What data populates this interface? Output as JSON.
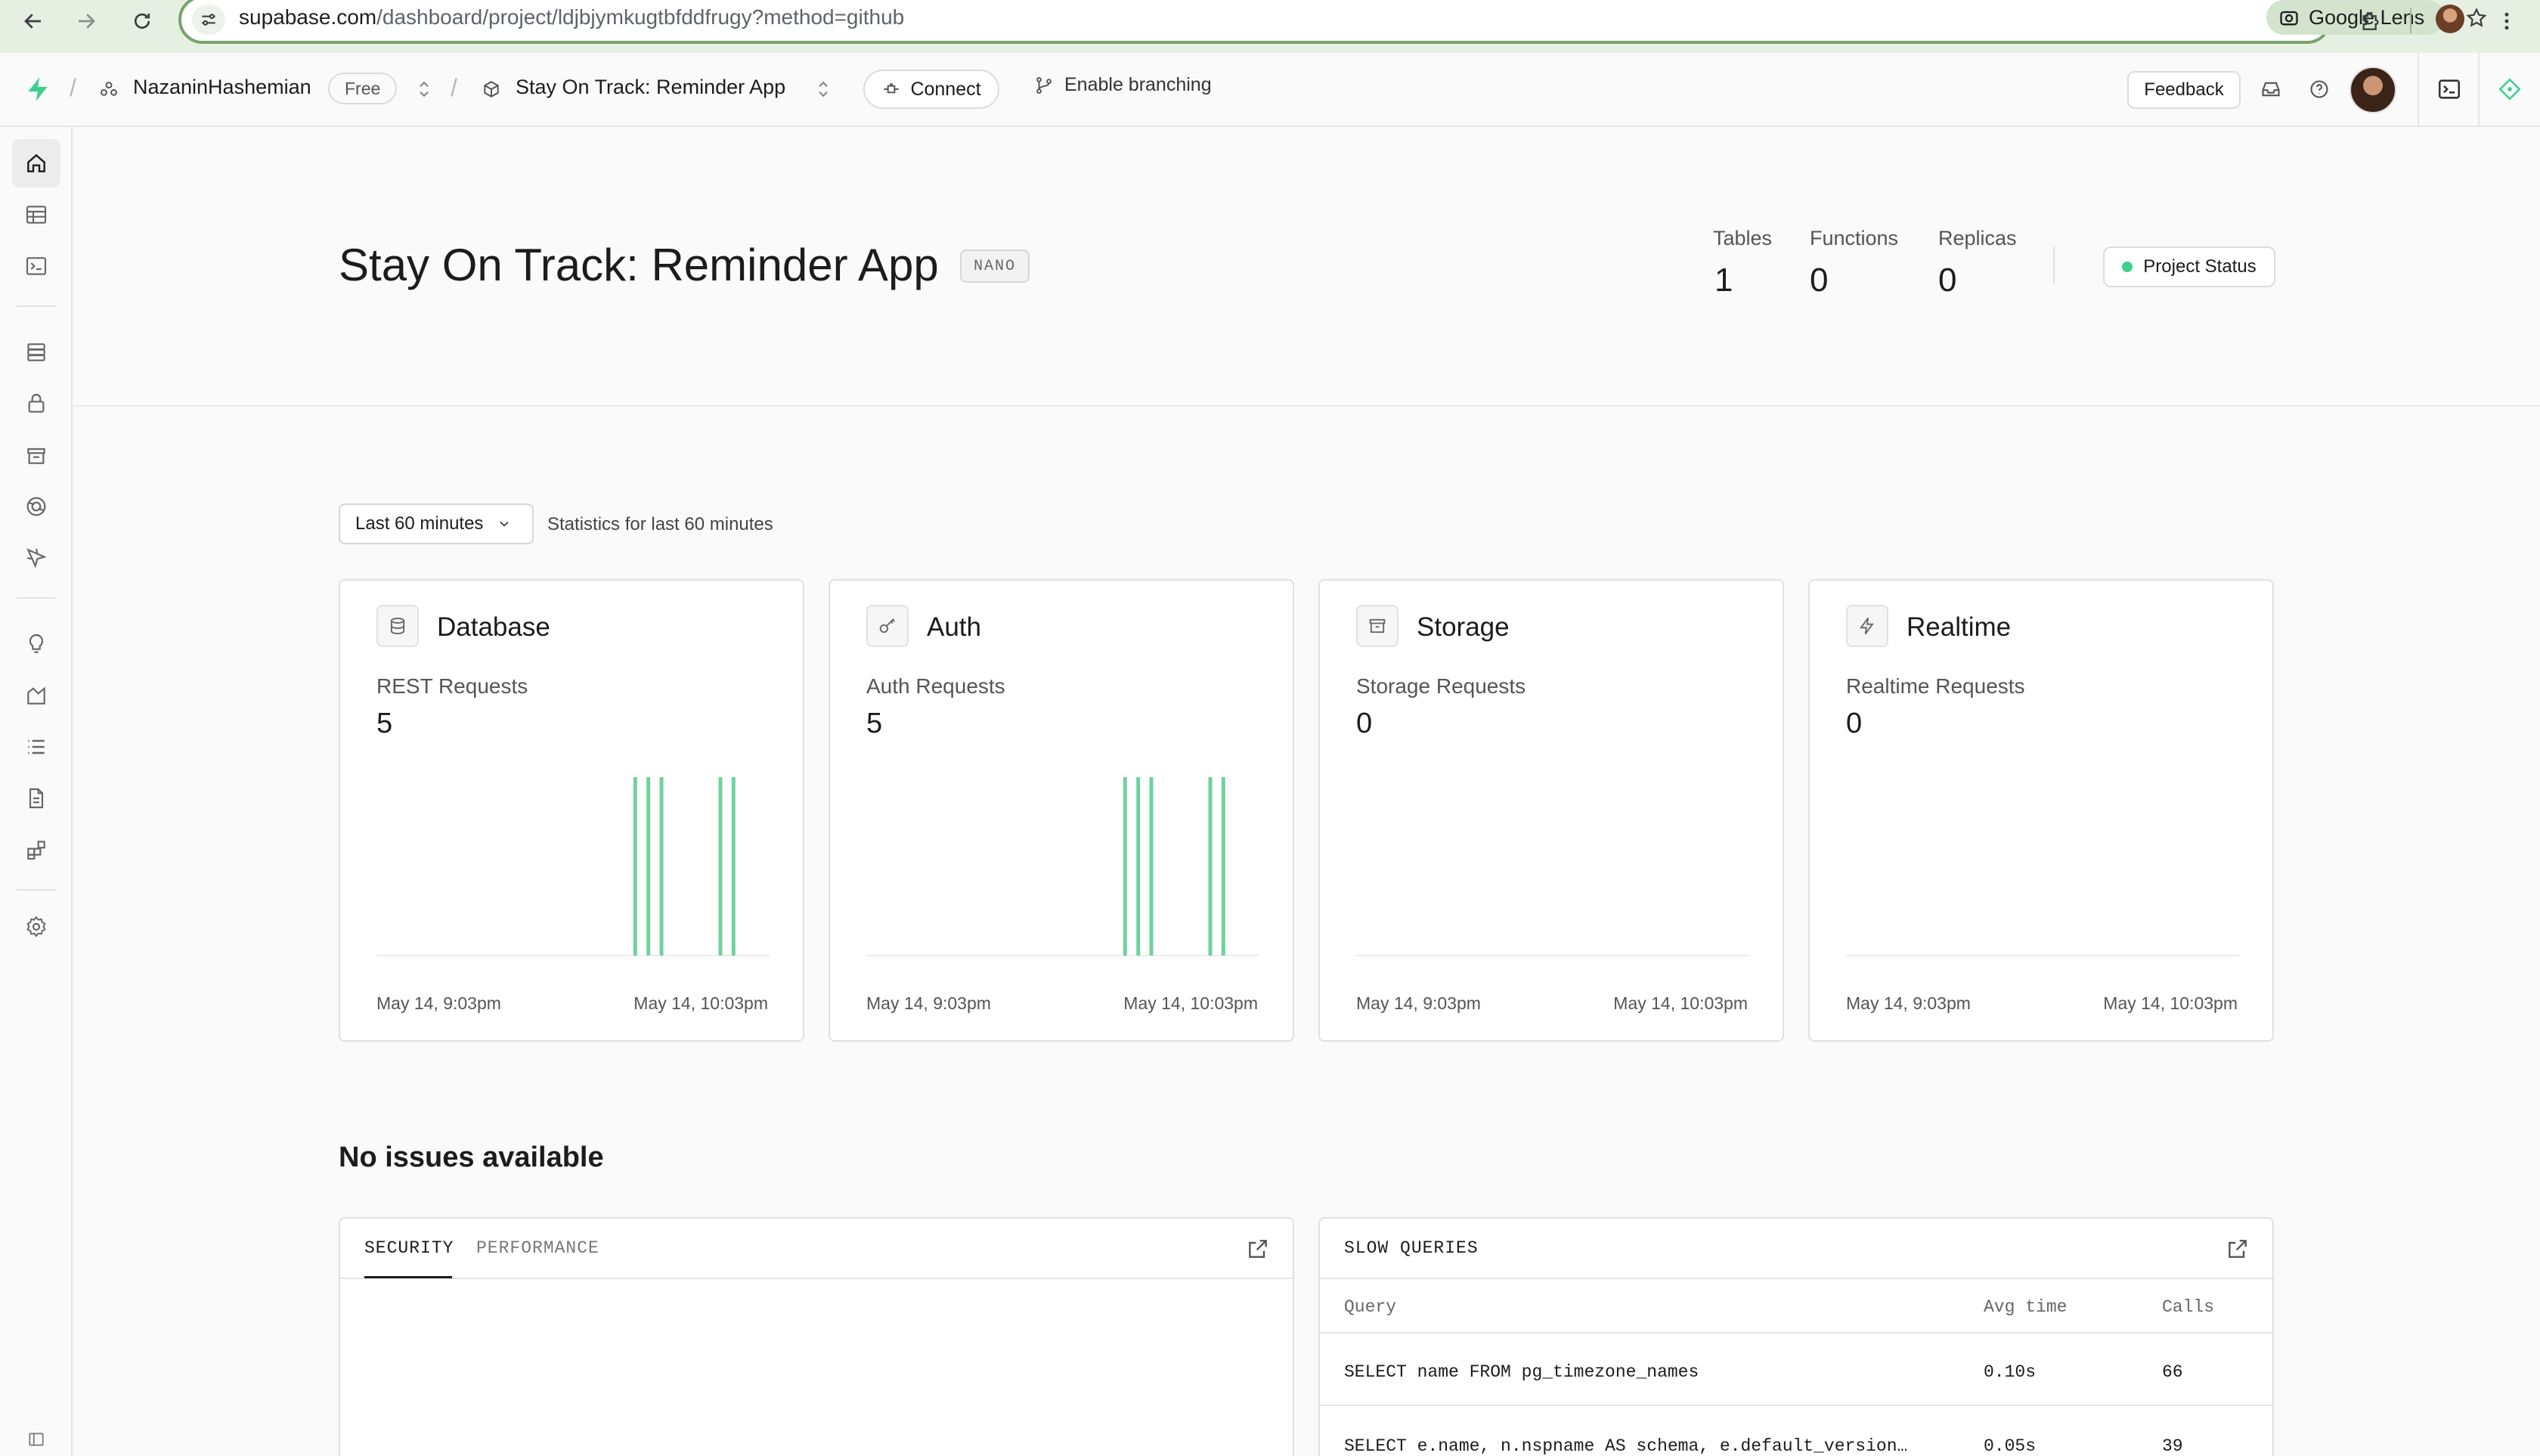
{
  "browser": {
    "url_domain": "supabase.com",
    "url_path": "/dashboard/project/ldjbjymkugtbfddfrugy?method=github",
    "lens_label": "Google Lens"
  },
  "header": {
    "org_name": "NazaninHashemian",
    "plan_badge": "Free",
    "project_name": "Stay On Track: Reminder App",
    "connect_label": "Connect",
    "branching_label": "Enable branching",
    "feedback_label": "Feedback"
  },
  "project": {
    "title": "Stay On Track: Reminder App",
    "size_badge": "NANO",
    "stats": [
      {
        "label": "Tables",
        "value": "1"
      },
      {
        "label": "Functions",
        "value": "0"
      },
      {
        "label": "Replicas",
        "value": "0"
      }
    ],
    "status_label": "Project Status"
  },
  "filter": {
    "range_label": "Last 60 minutes",
    "note": "Statistics for last 60 minutes"
  },
  "colors": {
    "accent": "#3ecf8e",
    "bar": "#6fd39b"
  },
  "cards": [
    {
      "title": "Database",
      "icon": "database-icon",
      "metric": "REST Requests",
      "value": "5",
      "axis_start": "May 14, 9:03pm",
      "axis_end": "May 14, 10:03pm"
    },
    {
      "title": "Auth",
      "icon": "key-icon",
      "metric": "Auth Requests",
      "value": "5",
      "axis_start": "May 14, 9:03pm",
      "axis_end": "May 14, 10:03pm"
    },
    {
      "title": "Storage",
      "icon": "archive-icon",
      "metric": "Storage Requests",
      "value": "0",
      "axis_start": "May 14, 9:03pm",
      "axis_end": "May 14, 10:03pm"
    },
    {
      "title": "Realtime",
      "icon": "bolt-icon",
      "metric": "Realtime Requests",
      "value": "0",
      "axis_start": "May 14, 9:03pm",
      "axis_end": "May 14, 10:03pm"
    }
  ],
  "chart_data": [
    {
      "type": "bar",
      "series": [
        {
          "values": [
            0,
            0,
            0,
            0,
            0,
            0,
            0,
            0,
            0,
            0,
            0,
            0,
            0,
            0,
            0,
            0,
            0,
            0,
            0,
            0,
            0,
            0,
            0,
            0,
            0,
            0,
            0,
            0,
            0,
            0,
            0,
            0,
            0,
            0,
            0,
            0,
            0,
            0,
            0,
            1,
            0,
            1,
            0,
            1,
            0,
            0,
            0,
            0,
            0,
            0,
            0,
            0,
            1,
            0,
            1,
            0,
            0,
            0,
            0,
            0
          ]
        }
      ],
      "x_range": [
        "May 14, 9:03pm",
        "May 14, 10:03pm"
      ]
    },
    {
      "type": "bar",
      "series": [
        {
          "values": [
            0,
            0,
            0,
            0,
            0,
            0,
            0,
            0,
            0,
            0,
            0,
            0,
            0,
            0,
            0,
            0,
            0,
            0,
            0,
            0,
            0,
            0,
            0,
            0,
            0,
            0,
            0,
            0,
            0,
            0,
            0,
            0,
            0,
            0,
            0,
            0,
            0,
            0,
            0,
            1,
            0,
            1,
            0,
            1,
            0,
            0,
            0,
            0,
            0,
            0,
            0,
            0,
            1,
            0,
            1,
            0,
            0,
            0,
            0,
            0
          ]
        }
      ],
      "x_range": [
        "May 14, 9:03pm",
        "May 14, 10:03pm"
      ]
    },
    {
      "type": "bar",
      "series": [
        {
          "values": []
        }
      ],
      "x_range": [
        "May 14, 9:03pm",
        "May 14, 10:03pm"
      ]
    },
    {
      "type": "bar",
      "series": [
        {
          "values": []
        }
      ],
      "x_range": [
        "May 14, 9:03pm",
        "May 14, 10:03pm"
      ]
    }
  ],
  "issues": {
    "title": "No issues available",
    "tabs": [
      "SECURITY",
      "PERFORMANCE"
    ]
  },
  "slow_queries": {
    "title": "SLOW QUERIES",
    "columns": [
      "Query",
      "Avg time",
      "Calls"
    ],
    "rows": [
      {
        "query": "SELECT name FROM pg_timezone_names",
        "avg": "0.10s",
        "calls": "66"
      },
      {
        "query": "SELECT e.name, n.nspname AS schema, e.default_version…",
        "avg": "0.05s",
        "calls": "39"
      }
    ]
  }
}
